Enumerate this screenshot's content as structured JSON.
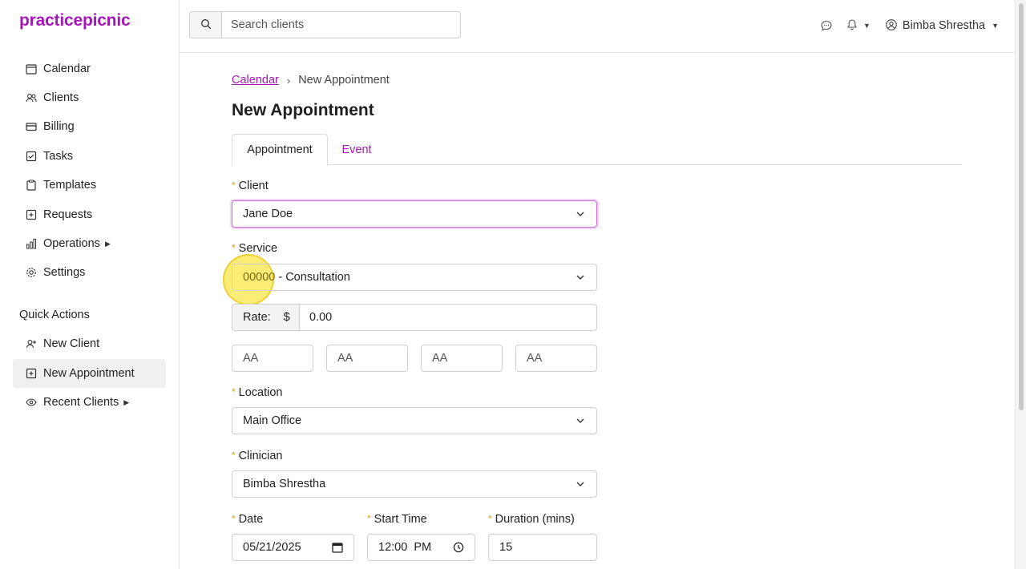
{
  "app": {
    "logo": "practicepicnic"
  },
  "sidebar": {
    "items": [
      {
        "label": "Calendar",
        "icon": "calendar-icon"
      },
      {
        "label": "Clients",
        "icon": "users-icon"
      },
      {
        "label": "Billing",
        "icon": "credit-card-icon"
      },
      {
        "label": "Tasks",
        "icon": "checkbox-icon"
      },
      {
        "label": "Templates",
        "icon": "clipboard-icon"
      },
      {
        "label": "Requests",
        "icon": "plus-square-icon"
      },
      {
        "label": "Operations",
        "icon": "bar-chart-icon"
      },
      {
        "label": "Settings",
        "icon": "gear-icon"
      }
    ],
    "quick_actions_label": "Quick Actions",
    "quick_actions": [
      {
        "label": "New Client",
        "icon": "user-plus-icon"
      },
      {
        "label": "New Appointment",
        "icon": "calendar-plus-icon",
        "active": true
      },
      {
        "label": "Recent Clients",
        "icon": "eye-icon"
      }
    ]
  },
  "topbar": {
    "search_placeholder": "Search clients",
    "user_name": "Bimba Shrestha"
  },
  "breadcrumb": {
    "parent": "Calendar",
    "separator": "›",
    "current": "New Appointment"
  },
  "page": {
    "title": "New Appointment"
  },
  "tabs": [
    {
      "label": "Appointment",
      "active": true
    },
    {
      "label": "Event",
      "active": false
    }
  ],
  "form": {
    "required_marker": "*",
    "client": {
      "label": "Client",
      "value": "Jane Doe"
    },
    "service": {
      "label": "Service",
      "code": "00000",
      "value": " - Consultation"
    },
    "rate": {
      "label": "Rate:",
      "currency": "$",
      "value": "0.00"
    },
    "modifiers": [
      "AA",
      "AA",
      "AA",
      "AA"
    ],
    "location": {
      "label": "Location",
      "value": "Main Office"
    },
    "clinician": {
      "label": "Clinician",
      "value": "Bimba Shrestha"
    },
    "date": {
      "label": "Date",
      "value": "05/21/2025"
    },
    "start_time": {
      "label": "Start Time",
      "value": "12:00  PM"
    },
    "duration": {
      "label": "Duration (mins)",
      "value": "15"
    }
  },
  "colors": {
    "brand": "#a418b8",
    "required": "#e59b1a",
    "highlight": "#f8e646"
  }
}
